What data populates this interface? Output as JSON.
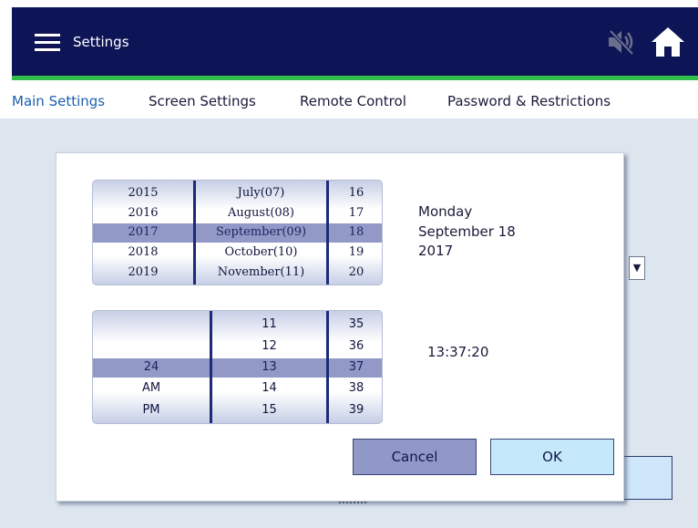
{
  "header": {
    "title": "Settings",
    "menu_icon": "hamburger-menu-icon",
    "mute_icon": "speaker-muted-icon",
    "home_icon": "home-icon",
    "bar_color": "#0d1557",
    "accent_color": "#2fbf4a"
  },
  "tabs": [
    {
      "label": "Main Settings",
      "active": true
    },
    {
      "label": "Screen Settings",
      "active": false
    },
    {
      "label": "Remote Control",
      "active": false
    },
    {
      "label": "Password & Restrictions",
      "active": false
    }
  ],
  "dialog": {
    "date_picker": {
      "years": [
        "2015",
        "2016",
        "2017",
        "2018",
        "2019"
      ],
      "months": [
        "July(07)",
        "August(08)",
        "September(09)",
        "October(10)",
        "November(11)"
      ],
      "days": [
        "16",
        "17",
        "18",
        "19",
        "20"
      ],
      "selected_index": 2
    },
    "time_picker": {
      "mode": [
        "",
        "",
        "24",
        "AM",
        "PM"
      ],
      "hours": [
        "11",
        "12",
        "13",
        "14",
        "15"
      ],
      "minutes": [
        "35",
        "36",
        "37",
        "38",
        "39"
      ],
      "selected_index": 2
    },
    "summary": {
      "day": "Monday",
      "date": "September 18",
      "year": "2017",
      "time": "13:37:20"
    },
    "cancel_label": "Cancel",
    "ok_label": "OK"
  },
  "background": {
    "dropdown_arrow": "▼"
  }
}
